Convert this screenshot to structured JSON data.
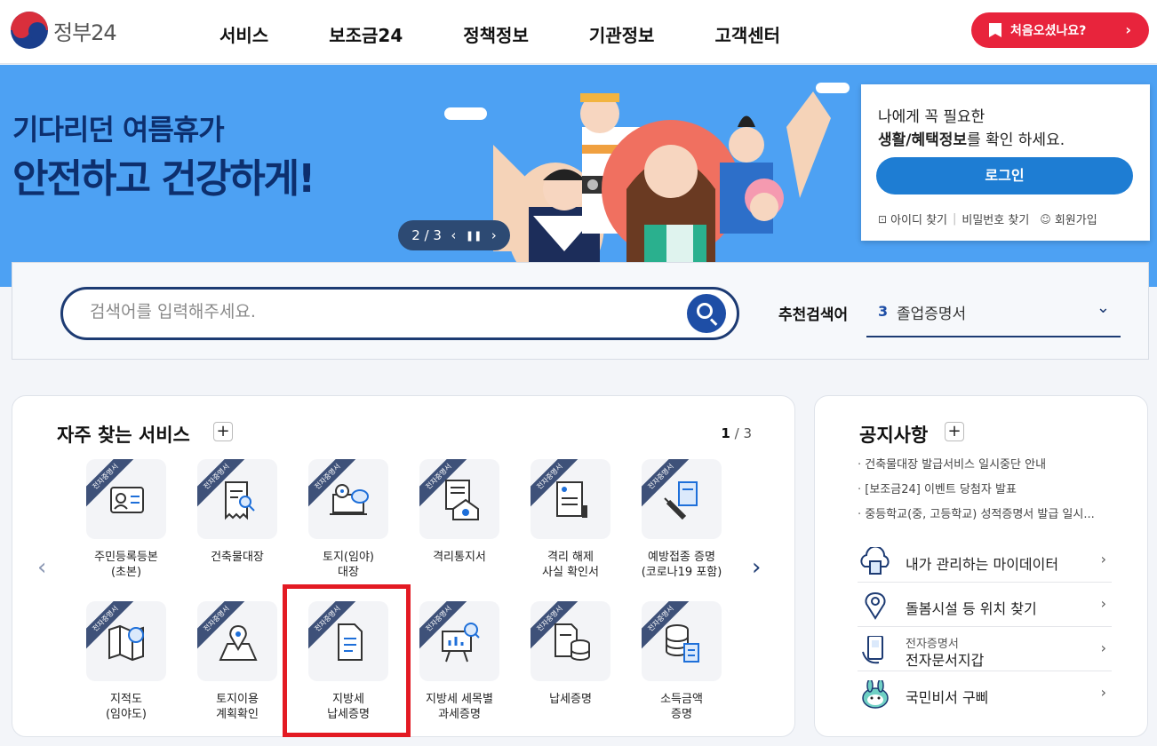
{
  "header": {
    "logo_text": "정부24",
    "nav": [
      "서비스",
      "보조금24",
      "정책정보",
      "기관정보",
      "고객센터"
    ],
    "first_visit_label": "처음오셨나요?"
  },
  "banner": {
    "line1": "기다리던 여름휴가",
    "line2": "안전하고 건강하게!",
    "pager_text": "2 / 3"
  },
  "login": {
    "line1": "나에게 꼭 필요한",
    "line2_bold": "생활/혜택정보",
    "line2_rest": "를 확인 하세요.",
    "button": "로그인",
    "find_id": "아이디 찾기",
    "find_pw": "비밀번호 찾기",
    "signup": "회원가입"
  },
  "search": {
    "placeholder": "검색어를 입력해주세요.",
    "recommend_label": "추천검색어",
    "recommend_num": "3",
    "recommend_text": "졸업증명서"
  },
  "services": {
    "title": "자주 찾는 서비스",
    "page_current": "1",
    "page_total": "/ 3",
    "ribbon": "전자증명서",
    "items": [
      {
        "label": "주민등록등본\n(초본)"
      },
      {
        "label": "건축물대장"
      },
      {
        "label": "토지(임야)\n대장"
      },
      {
        "label": "격리통지서"
      },
      {
        "label": "격리 해제\n사실 확인서"
      },
      {
        "label": "예방접종 증명\n(코로나19 포함)"
      },
      {
        "label": "지적도\n(임야도)"
      },
      {
        "label": "토지이용\n계획확인"
      },
      {
        "label": "지방세\n납세증명"
      },
      {
        "label": "지방세 세목별\n과세증명"
      },
      {
        "label": "납세증명"
      },
      {
        "label": "소득금액\n증명"
      }
    ]
  },
  "notice": {
    "title": "공지사항",
    "items": [
      "건축물대장 발급서비스 일시중단 안내",
      "[보조금24] 이벤트 당첨자 발표",
      "중등학교(중, 고등학교) 성적증명서 발급 일시..."
    ],
    "quick": [
      {
        "text": "내가 관리하는 마이데이터"
      },
      {
        "text": "돌봄시설 등 위치 찾기"
      },
      {
        "sub": "전자증명서",
        "text": "전자문서지갑"
      },
      {
        "text": "국민비서 구삐"
      }
    ]
  },
  "colors": {
    "brand_red": "#e8243c",
    "navy": "#1d3b73",
    "banner_blue": "#4da1f3",
    "login_blue": "#1e7dd3",
    "highlight_red": "#e31a23"
  }
}
